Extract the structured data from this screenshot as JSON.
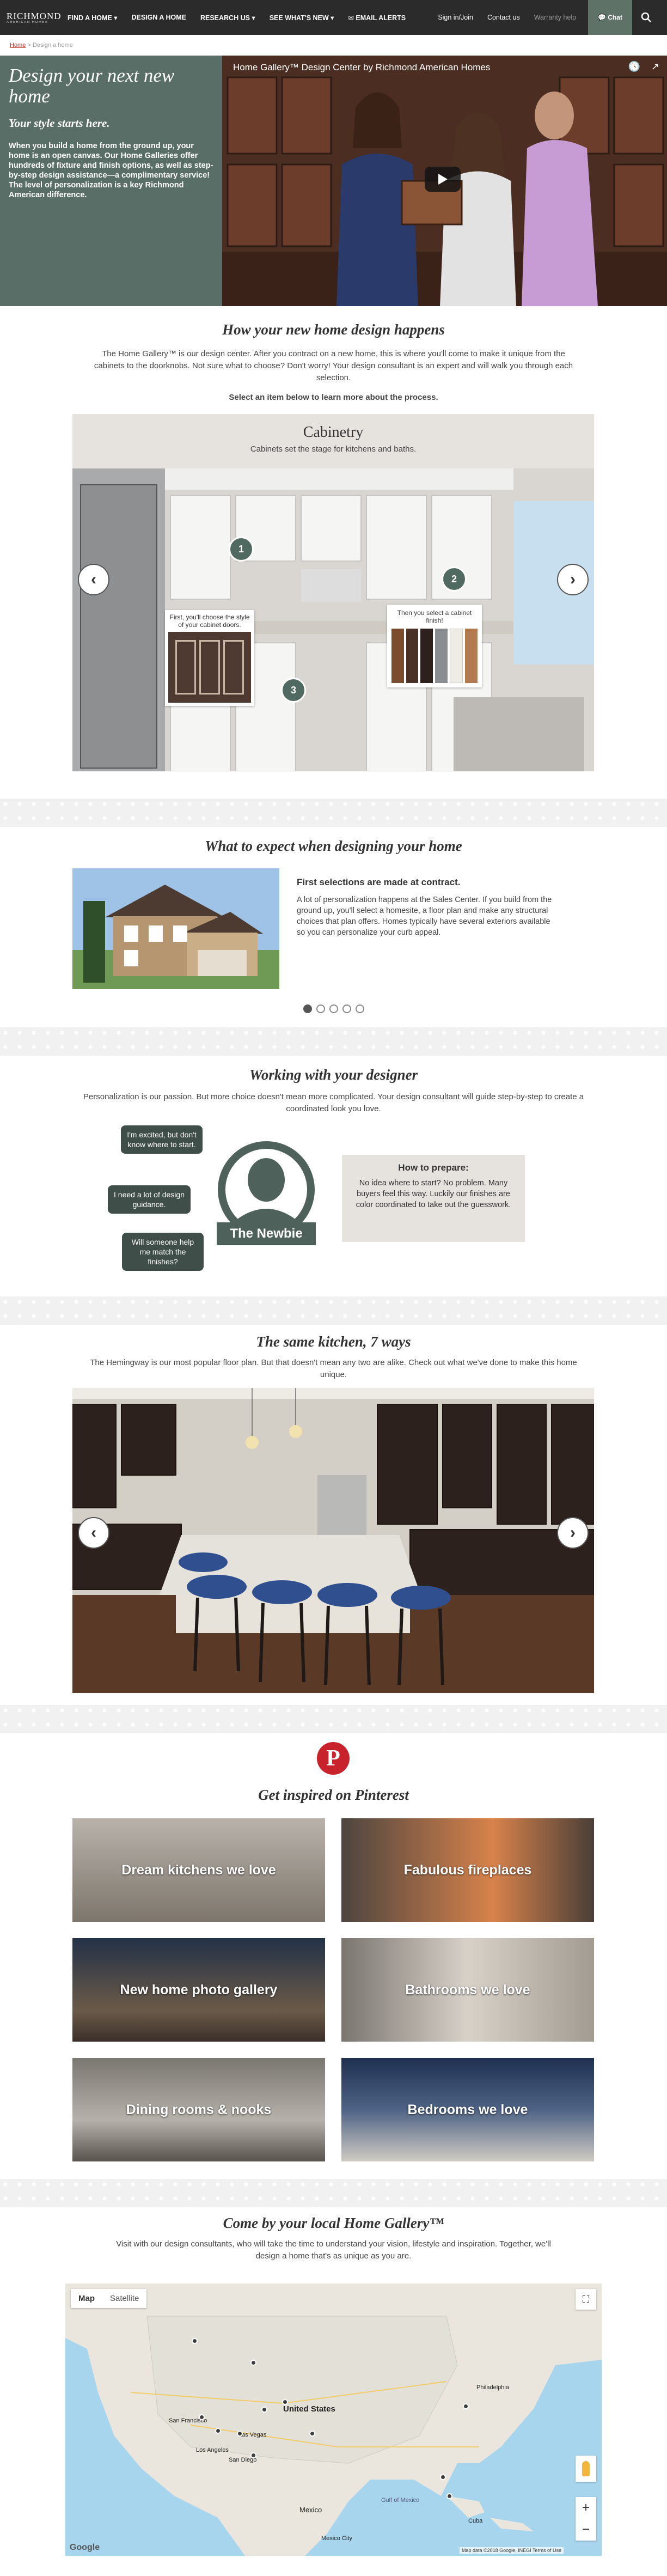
{
  "brand": {
    "line1": "RICHMOND",
    "line2": "AMERICAN HOMES"
  },
  "nav": {
    "items": [
      "FIND A HOME",
      "DESIGN A HOME",
      "RESEARCH US",
      "SEE WHAT'S NEW",
      "EMAIL ALERTS"
    ],
    "signin": "Sign in/Join",
    "contact": "Contact us",
    "warranty": "Warranty help",
    "chat": "Chat"
  },
  "breadcrumb": {
    "home": "Home",
    "sep": ">",
    "current": "Design a home"
  },
  "hero": {
    "title": "Design your next new home",
    "subtitle": "Your style starts here.",
    "body": "When you build a home from the ground up, your home is an open canvas. Our Home Galleries offer hundreds of fixture and finish options, as well as step-by-step design assistance—a complimentary service! The level of personalization is a key Richmond American difference.",
    "video_title": "Home Gallery™ Design Center by Richmond American Homes"
  },
  "process": {
    "title": "How your new home design happens",
    "body": "The Home Gallery™ is our design center. After you contract on a new home, this is where you'll come to make it unique from the cabinets to the doorknobs. Not sure what to choose? Don't worry! Your design consultant is an expert and will walk you through each selection.",
    "cta": "Select an item below to learn more about the process.",
    "slide_title": "Cabinetry",
    "slide_sub": "Cabinets set the stage for kitchens and baths.",
    "step1": "First, you'll choose the style of your cabinet doors.",
    "step2": "Then you select a cabinet finish!",
    "n1": "1",
    "n2": "2",
    "n3": "3"
  },
  "expect": {
    "title": "What to expect when designing your home",
    "heading": "First selections are made at contract.",
    "body": "A lot of personalization happens at the Sales Center. If you build from the ground up, you'll select a homesite, a floor plan and make any structural choices that plan offers. Homes typically have several exteriors available so you can personalize your curb appeal."
  },
  "designer": {
    "title": "Working with your designer",
    "body": "Personalization is our passion. But more choice doesn't mean more complicated. Your design consultant will guide step-by-step to create a coordinated look you love.",
    "b1": "I'm excited, but don't know where to start.",
    "b2": "I need a lot of design guidance.",
    "b3": "Will someone help me match the finishes?",
    "persona": "The Newbie",
    "prep_title": "How to prepare:",
    "prep_body": "No idea where to start? No problem. Many buyers feel this way. Luckily our finishes are color coordinated to take out the guesswork."
  },
  "kitchen": {
    "title": "The same kitchen, 7 ways",
    "body": "The Hemingway is our most popular floor plan. But that doesn't mean any two are alike. Check out what we've done to make this home unique."
  },
  "pinterest": {
    "title": "Get inspired on Pinterest",
    "tiles": [
      "Dream kitchens we love",
      "Fabulous fireplaces",
      "New home photo gallery",
      "Bathrooms we love",
      "Dining rooms & nooks",
      "Bedrooms we love"
    ]
  },
  "gallery": {
    "title": "Come by your local Home Gallery™",
    "body": "Visit with our design consultants, who will take the time to understand your vision, lifestyle and inspiration. Together, we'll design a home that's as unique as you are."
  },
  "map": {
    "tab_map": "Map",
    "tab_sat": "Satellite",
    "labels": [
      "United States",
      "San Francisco",
      "Los Angeles",
      "San Diego",
      "Las Vegas",
      "Mexico",
      "Mexico City",
      "Cuba",
      "Gulf of Mexico",
      "Philadelphia"
    ],
    "footer": "Map data ©2018 Google, INEGI    Terms of Use",
    "google": "Google"
  },
  "colors": {
    "accent": "#5a6e68",
    "nav": "#2b2b2b",
    "pinterest": "#c8232c"
  }
}
